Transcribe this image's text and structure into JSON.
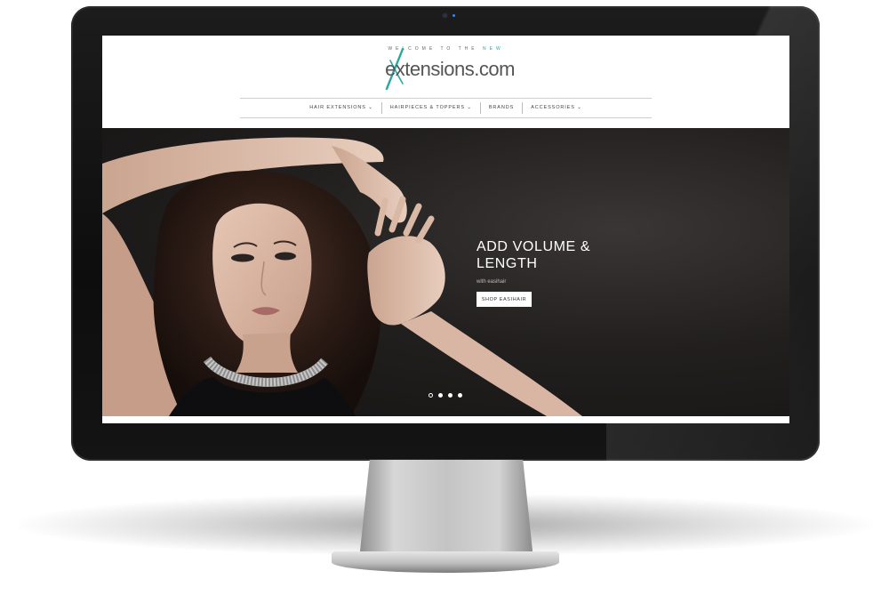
{
  "site": {
    "tagline_prefix": "WELCOME TO THE",
    "tagline_accent": "NEW",
    "logo_text": "extensions.com",
    "colors": {
      "accent": "#2aa7a0",
      "text": "#555555",
      "hero_bg": "#1e1b1b",
      "button_bg": "#ffffff"
    }
  },
  "nav": {
    "items": [
      {
        "label": "HAIR EXTENSIONS ⌄"
      },
      {
        "label": "HAIRPIECES & TOPPERS ⌄"
      },
      {
        "label": "BRANDS"
      },
      {
        "label": "ACCESSORIES ⌄"
      }
    ]
  },
  "hero": {
    "heading": "ADD VOLUME & LENGTH",
    "subtext": "with easihair",
    "button_label": "SHOP EASIHAIR",
    "slides_count": 4,
    "active_slide": 1
  }
}
